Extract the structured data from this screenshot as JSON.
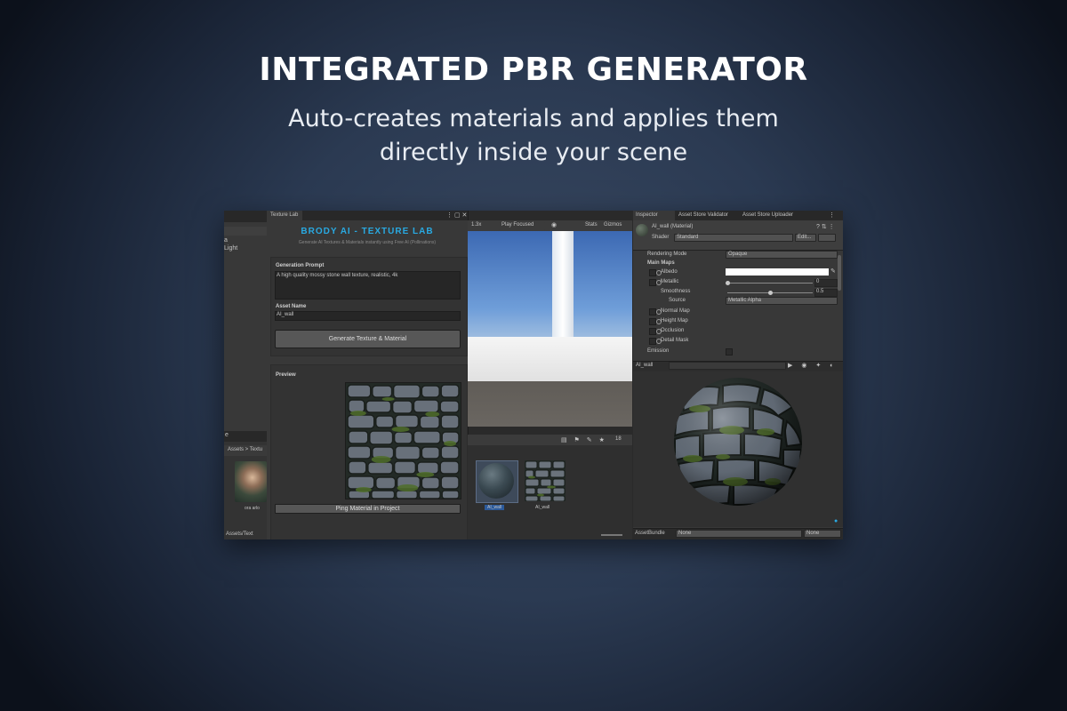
{
  "promo": {
    "headline": "INTEGRATED PBR GENERATOR",
    "subline_1": "Auto-creates materials and applies them",
    "subline_2": "directly inside your scene"
  },
  "hierarchy": {
    "item_1": "a",
    "item_2": "Light"
  },
  "project": {
    "tab_label": "e",
    "breadcrumb": "Assets > Textu",
    "asset_label": "ora arlo",
    "footer_path": "Assets/Text"
  },
  "texture_lab": {
    "tab_label": "Texture Lab",
    "title": "BRODY AI - TEXTURE LAB",
    "subtitle": "Generate AI Textures & Materials instantly using Free AI (Pollinations)",
    "prompt_label": "Generation Prompt",
    "prompt_value": "A high quality mossy stone wall texture, realistic, 4k",
    "asset_name_label": "Asset Name",
    "asset_name_value": "AI_wall",
    "generate_button": "Generate Texture & Material",
    "preview_label": "Preview",
    "ping_button": "Ping Material in Project"
  },
  "scene": {
    "zoom": "1.3x",
    "play_mode": "Play Focused",
    "stats": "Stats",
    "gizmos": "Gizmos",
    "hidden_count": "18",
    "assets": [
      {
        "label": "AI_wall"
      },
      {
        "label": "AI_wall"
      }
    ]
  },
  "inspector": {
    "tabs": [
      "Inspector",
      "Asset Store Validator",
      "Asset Store Uploader"
    ],
    "material_name": "AI_wall (Material)",
    "shader_label": "Shader",
    "shader_value": "Standard",
    "edit_button": "Edit...",
    "rendering_mode_label": "Rendering Mode",
    "rendering_mode_value": "Opaque",
    "main_maps_label": "Main Maps",
    "albedo_label": "Albedo",
    "metallic_label": "Metallic",
    "metallic_value": "0",
    "smoothness_label": "Smoothness",
    "smoothness_value": "0.5",
    "source_label": "Source",
    "source_value": "Metallic Alpha",
    "normal_map_label": "Normal Map",
    "height_map_label": "Height Map",
    "occlusion_label": "Occlusion",
    "detail_mask_label": "Detail Mask",
    "emission_label": "Emission",
    "preview_name": "AI_wall",
    "assetbundle_label": "AssetBundle",
    "assetbundle_value": "None",
    "variant_value": "None",
    "metallic_level": 0.0,
    "smoothness_level": 0.5
  },
  "colors": {
    "accent": "#29a9e1",
    "panel": "#383838",
    "dark_panel": "#282828",
    "button": "#575757"
  }
}
